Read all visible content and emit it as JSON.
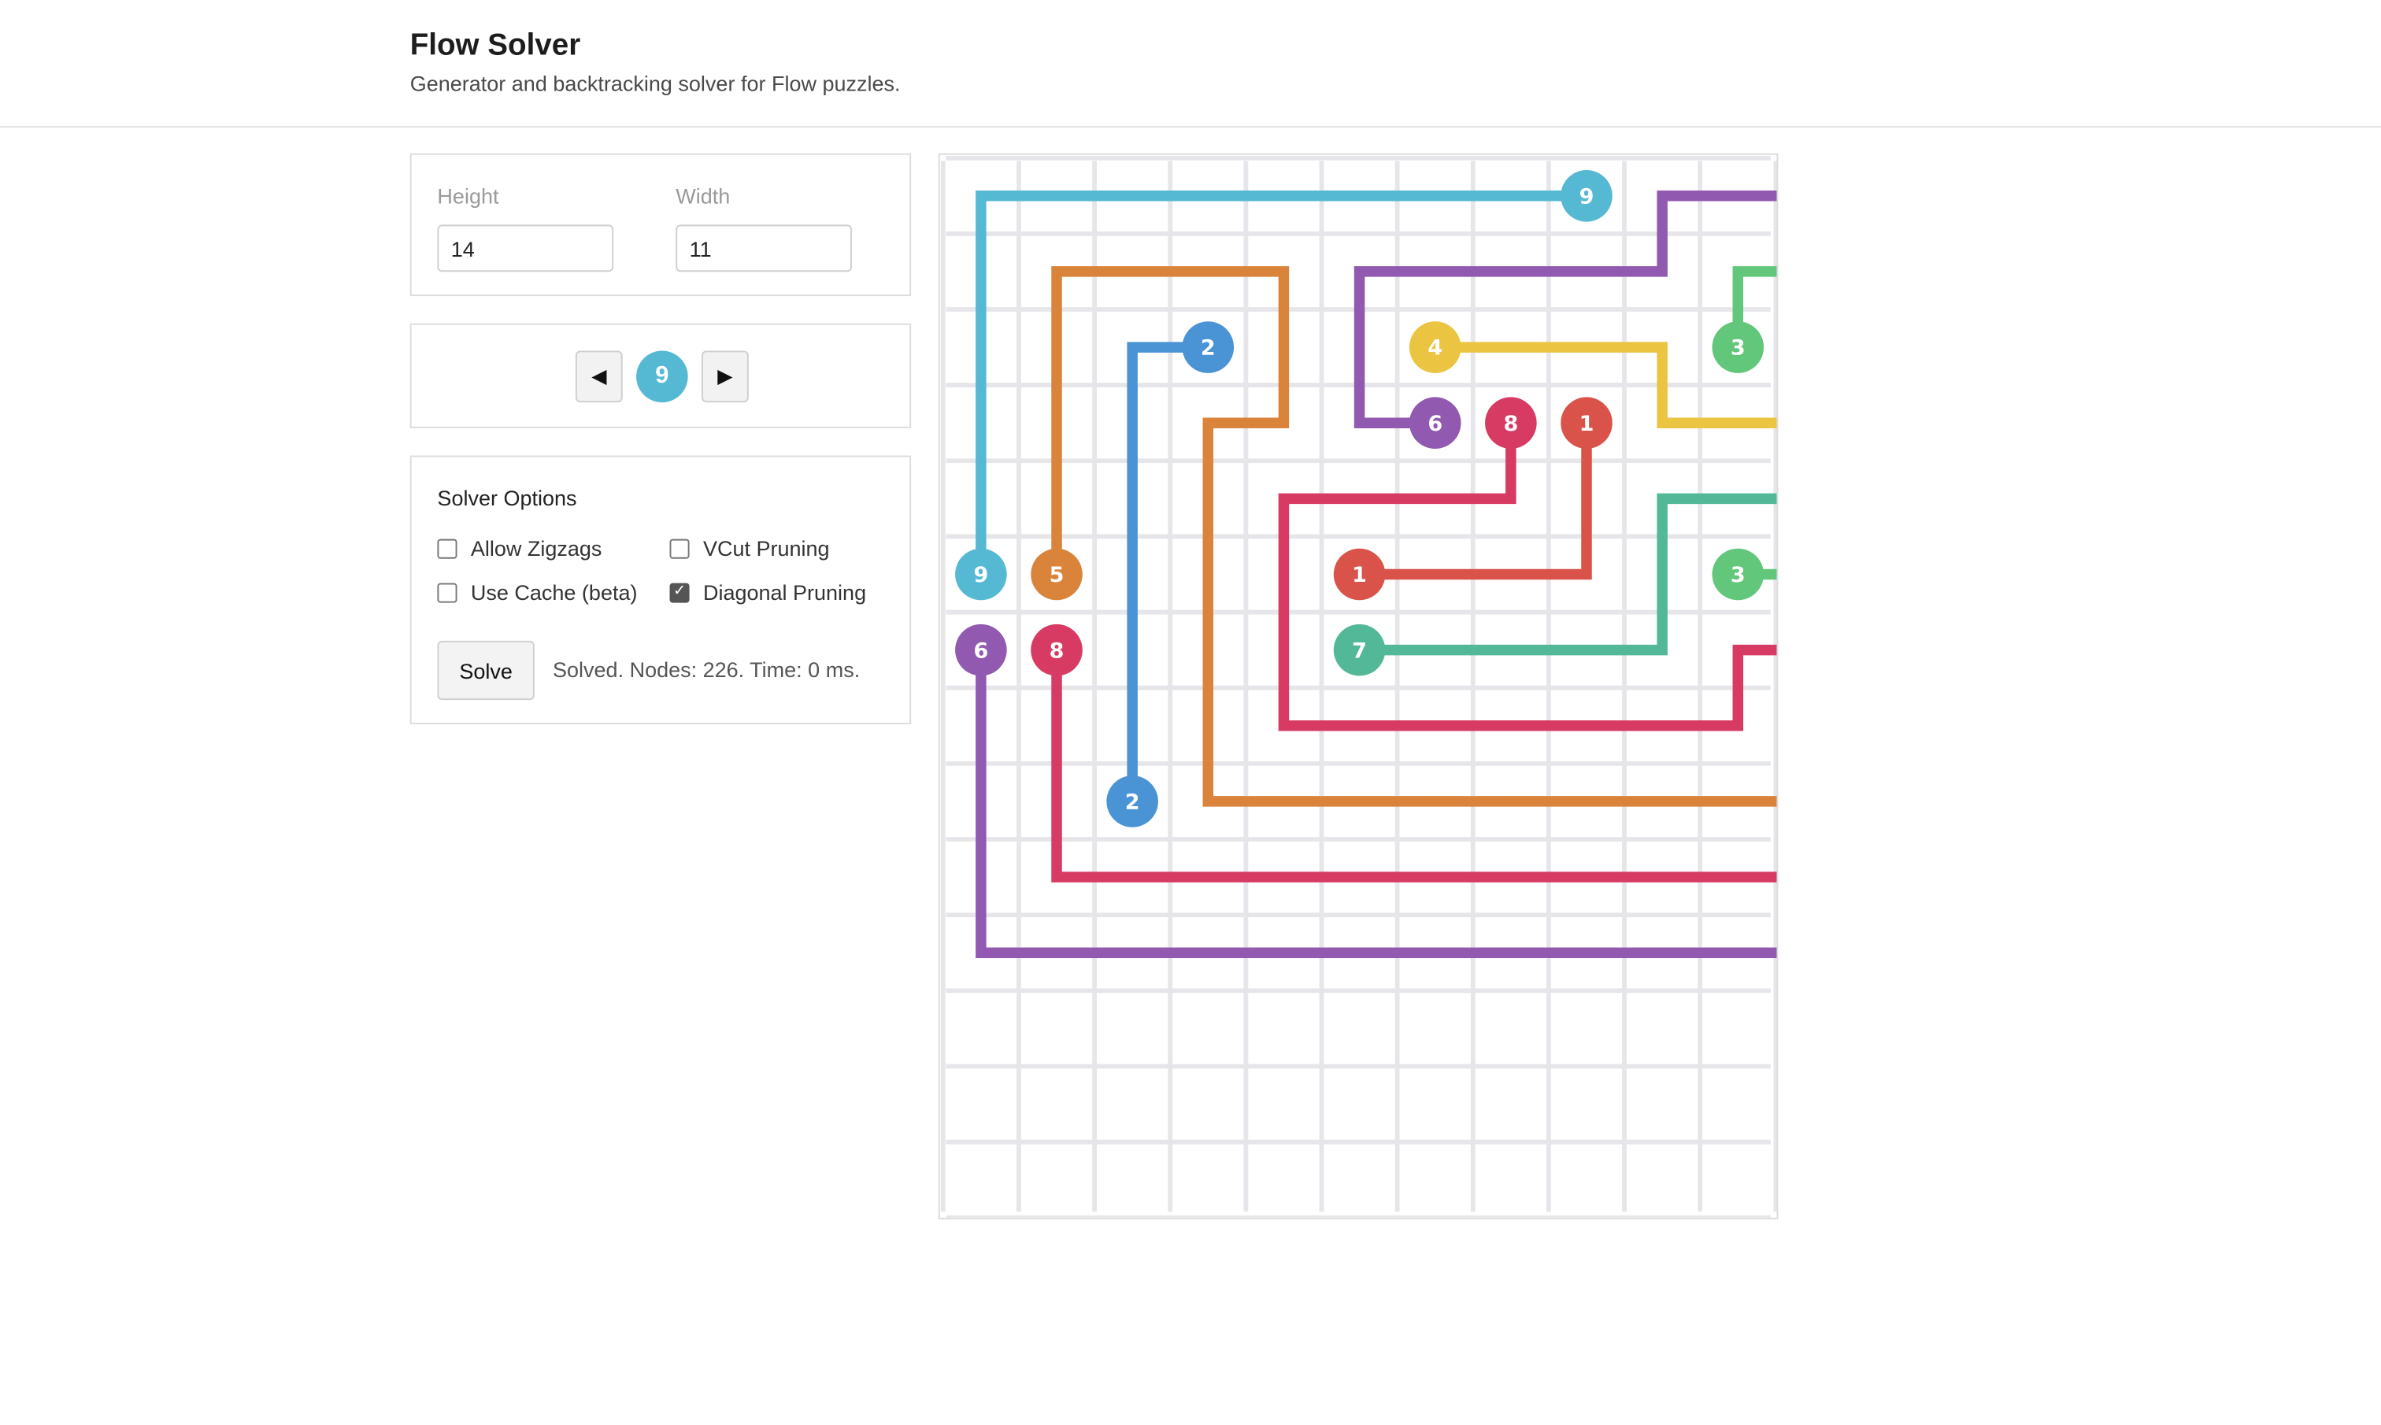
{
  "app": {
    "title": "Flow Solver",
    "subtitle": "Generator and backtracking solver for Flow puzzles."
  },
  "dimensions": {
    "height_label": "Height",
    "height_value": "14",
    "width_label": "Width",
    "width_value": "11"
  },
  "navigator": {
    "prev_label": "◀",
    "next_label": "▶",
    "current_color": "9",
    "current_color_hex": "#55b9d3"
  },
  "solver_options": {
    "title": "Solver Options",
    "options": [
      {
        "label": "Allow Zigzags",
        "checked": false
      },
      {
        "label": "VCut Pruning",
        "checked": false
      },
      {
        "label": "Use Cache (beta)",
        "checked": false
      },
      {
        "label": "Diagonal Pruning",
        "checked": true
      }
    ],
    "solve_label": "Solve",
    "status": "Solved. Nodes: 226. Time: 0 ms."
  },
  "board": {
    "rows": 14,
    "cols": 11,
    "grid_color": "#e6e6ea",
    "colors": {
      "1": "#d9534a",
      "2": "#4a94d6",
      "3": "#62c77a",
      "4": "#ebc441",
      "5": "#da843b",
      "6": "#9159b0",
      "7": "#52b898",
      "8": "#d73a63",
      "9": "#55b9d3"
    },
    "flows": [
      {
        "id": "9",
        "path": [
          [
            0,
            5
          ],
          [
            0,
            0
          ],
          [
            8,
            0
          ]
        ]
      },
      {
        "id": "6",
        "path": [
          [
            0,
            6
          ],
          [
            0,
            10
          ],
          [
            13,
            10
          ],
          [
            13,
            0
          ],
          [
            9,
            0
          ],
          [
            9,
            1
          ],
          [
            5,
            1
          ],
          [
            5,
            3
          ],
          [
            6,
            3
          ]
        ]
      },
      {
        "id": "5",
        "path": [
          [
            1,
            5
          ],
          [
            1,
            1
          ],
          [
            4,
            1
          ],
          [
            4,
            3
          ],
          [
            3,
            3
          ],
          [
            3,
            8
          ],
          [
            11,
            8
          ],
          [
            11,
            7
          ]
        ]
      },
      {
        "id": "8",
        "path": [
          [
            1,
            6
          ],
          [
            1,
            9
          ],
          [
            12,
            9
          ],
          [
            12,
            6
          ],
          [
            10,
            6
          ],
          [
            10,
            7
          ],
          [
            4,
            7
          ],
          [
            4,
            4
          ],
          [
            7,
            4
          ],
          [
            7,
            3
          ]
        ]
      },
      {
        "id": "2",
        "path": [
          [
            2,
            8
          ],
          [
            2,
            2
          ],
          [
            3,
            2
          ]
        ]
      },
      {
        "id": "1",
        "path": [
          [
            5,
            5
          ],
          [
            8,
            5
          ],
          [
            8,
            3
          ]
        ]
      },
      {
        "id": "7",
        "path": [
          [
            5,
            6
          ],
          [
            9,
            6
          ],
          [
            9,
            4
          ],
          [
            11,
            4
          ]
        ]
      },
      {
        "id": "4",
        "path": [
          [
            6,
            2
          ],
          [
            9,
            2
          ],
          [
            9,
            3
          ],
          [
            11,
            3
          ],
          [
            11,
            2
          ]
        ]
      },
      {
        "id": "3",
        "path": [
          [
            10,
            2
          ],
          [
            10,
            1
          ],
          [
            12,
            1
          ],
          [
            12,
            5
          ],
          [
            10,
            5
          ]
        ]
      }
    ],
    "endpoints": [
      {
        "id": "9",
        "cell": [
          0,
          5
        ]
      },
      {
        "id": "6",
        "cell": [
          0,
          6
        ]
      },
      {
        "id": "5",
        "cell": [
          1,
          5
        ]
      },
      {
        "id": "8",
        "cell": [
          1,
          6
        ]
      },
      {
        "id": "2",
        "cell": [
          2,
          8
        ]
      },
      {
        "id": "2",
        "cell": [
          3,
          2
        ]
      },
      {
        "id": "1",
        "cell": [
          5,
          5
        ]
      },
      {
        "id": "7",
        "cell": [
          5,
          6
        ]
      },
      {
        "id": "4",
        "cell": [
          6,
          2
        ]
      },
      {
        "id": "6",
        "cell": [
          6,
          3
        ]
      },
      {
        "id": "8",
        "cell": [
          7,
          3
        ]
      },
      {
        "id": "9",
        "cell": [
          8,
          0
        ]
      },
      {
        "id": "1",
        "cell": [
          8,
          3
        ]
      },
      {
        "id": "3",
        "cell": [
          10,
          2
        ]
      },
      {
        "id": "3",
        "cell": [
          10,
          5
        ]
      },
      {
        "id": "4",
        "cell": [
          11,
          2
        ]
      },
      {
        "id": "7",
        "cell": [
          11,
          4
        ]
      },
      {
        "id": "5",
        "cell": [
          11,
          7
        ]
      }
    ]
  }
}
